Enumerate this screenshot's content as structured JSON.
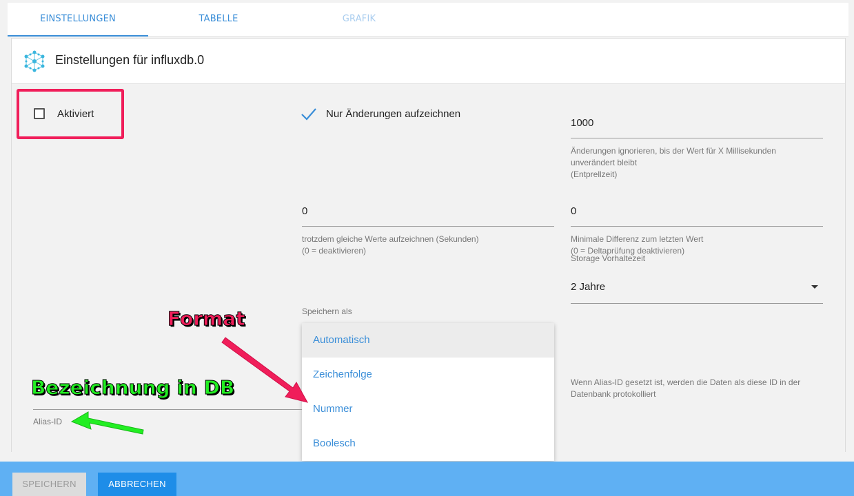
{
  "tabs": [
    {
      "label": "EINSTELLUNGEN",
      "active": true
    },
    {
      "label": "TABELLE",
      "active": false
    },
    {
      "label": "GRAFIK",
      "active": false,
      "disabled": true
    }
  ],
  "header": {
    "title": "Einstellungen für influxdb.0",
    "icon": "influxdb-molecule-icon"
  },
  "settings": {
    "enabled": {
      "label": "Aktiviert",
      "checked": false
    },
    "only_changes": {
      "label": "Nur Änderungen aufzeichnen",
      "checked": true
    },
    "debounce": {
      "value": "1000",
      "helper_line1": "Änderungen ignorieren, bis der Wert für X Millisekunden",
      "helper_line2": "unverändert bleibt",
      "helper_line3": "(Entprellzeit)"
    },
    "same_values": {
      "value": "0",
      "helper_line1": "trotzdem gleiche Werte aufzeichnen (Sekunden)",
      "helper_line2": "(0 = deaktivieren)"
    },
    "min_diff": {
      "value": "0",
      "helper_line1": "Minimale Differenz zum letzten Wert",
      "helper_line2": "(0 = Deltaprüfung deaktivieren)"
    },
    "retention": {
      "label": "Storage Vorhaltezeit",
      "value": "2 Jahre"
    },
    "store_as": {
      "label": "Speichern als",
      "options": [
        "Automatisch",
        "Zeichenfolge",
        "Nummer",
        "Boolesch"
      ],
      "selected": "Automatisch"
    },
    "alias": {
      "label": "Alias-ID",
      "value": "",
      "helper_line1": "Wenn Alias-ID gesetzt ist, werden die Daten als diese ID in der",
      "helper_line2": "Datenbank protokolliert"
    }
  },
  "annotations": {
    "format": "Format",
    "db_name": "Bezeichnung in DB"
  },
  "footer": {
    "save_label": "SPEICHERN",
    "cancel_label": "ABBRECHEN"
  },
  "colors": {
    "accent": "#3a8ed8",
    "highlight": "#f01e5a",
    "annotation_green": "#22ee22",
    "footer": "#5fb0f3"
  }
}
